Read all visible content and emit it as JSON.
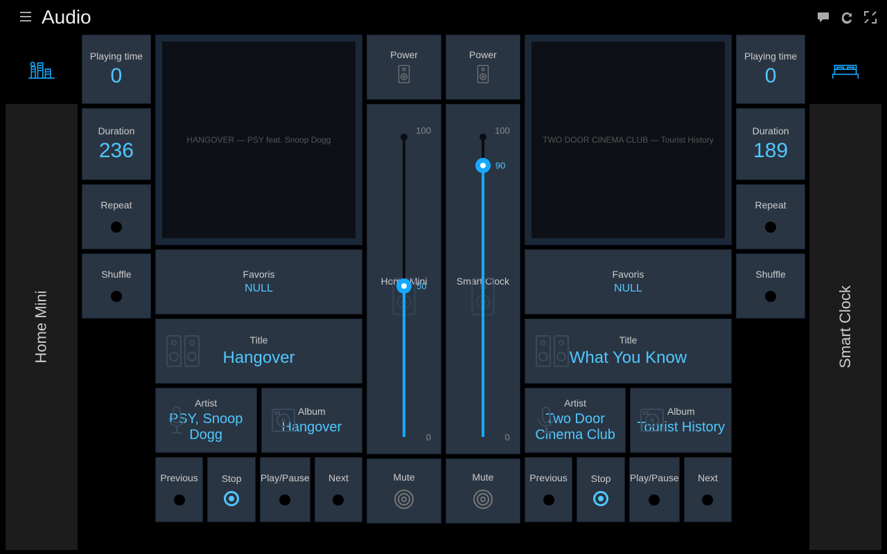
{
  "header": {
    "title": "Audio"
  },
  "labels": {
    "playing_time": "Playing time",
    "duration": "Duration",
    "repeat": "Repeat",
    "shuffle": "Shuffle",
    "favoris": "Favoris",
    "title": "Title",
    "artist": "Artist",
    "album": "Album",
    "prev": "Previous",
    "stop": "Stop",
    "play": "Play/Pause",
    "next": "Next",
    "power": "Power",
    "mute": "Mute",
    "slider_max": "100",
    "slider_min": "0"
  },
  "left": {
    "device": "Home Mini",
    "playing_time": "0",
    "duration": "236",
    "favoris": "NULL",
    "title": "Hangover",
    "artist": "PSY, Snoop Dogg",
    "album": "Hangover",
    "art_text": "HANGOVER — PSY feat. Snoop Dogg",
    "volume": 50
  },
  "center": {
    "slider1_name": "Home Mini",
    "slider2_name": "Smart Clock"
  },
  "right": {
    "device": "Smart Clock",
    "playing_time": "0",
    "duration": "189",
    "favoris": "NULL",
    "title": "What You Know",
    "artist": "Two Door Cinema Club",
    "album": "Tourist History",
    "art_text": "TWO DOOR CINEMA CLUB — Tourist History",
    "volume": 90
  }
}
